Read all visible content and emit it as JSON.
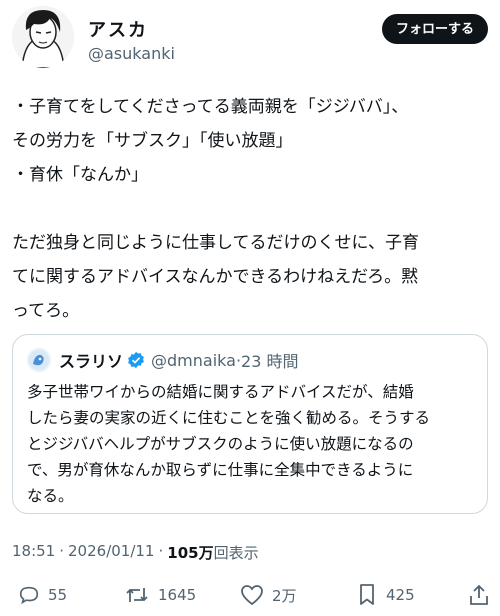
{
  "author": {
    "name": "アスカ",
    "handle": "@asukanki"
  },
  "follow_label": "フォローする",
  "tweet_lines": [
    "・子育てをしてくださってる義両親を「ジジババ」、",
    "その労力を「サブスク」「使い放題」",
    "・育休「なんか」",
    "",
    "ただ独身と同じように仕事してるだけのくせに、子育",
    "てに関するアドバイスなんかできるわけねえだろ。黙",
    "ってろ。"
  ],
  "quoted": {
    "name": "スラリソ",
    "handle": "@dmnaika",
    "separator": "·",
    "time": "23 時間",
    "text": "多子世帯ワイからの結婚に関するアドバイスだが、結婚\nしたら妻の実家の近くに住むことを強く勧める。そうする\nとジジババヘルプがサブスクのように使い放題になるの\nで、男が育休なんか取らずに仕事に全集中できるように\nなる。"
  },
  "meta": {
    "time": "18:51",
    "dot": "·",
    "date": "2026/01/11",
    "dot2": "·",
    "views": "105万",
    "views_label": "回表示"
  },
  "actions": {
    "replies": "55",
    "reposts": "1645",
    "likes": "2万",
    "bookmarks": "425"
  },
  "colors": {
    "text": "#0f1419",
    "secondary": "#536471",
    "border": "#cfd9de",
    "verified": "#1d9bf0"
  }
}
